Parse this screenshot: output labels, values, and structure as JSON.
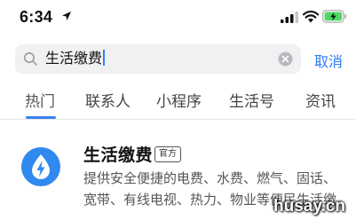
{
  "status_bar": {
    "time": "6:34",
    "location_icon": "location-arrow-icon",
    "signal_icon": "cellular-signal-icon",
    "wifi_icon": "wifi-icon",
    "battery_icon": "battery-charging-icon",
    "battery_color": "#4cd964"
  },
  "search": {
    "icon": "search-icon",
    "value": "生活缴费",
    "clear_icon": "clear-icon",
    "cancel_label": "取消"
  },
  "tabs": [
    {
      "label": "热门",
      "active": true
    },
    {
      "label": "联系人",
      "active": false
    },
    {
      "label": "小程序",
      "active": false
    },
    {
      "label": "生活号",
      "active": false
    },
    {
      "label": "资讯",
      "active": false
    }
  ],
  "result": {
    "logo_icon": "water-drop-lightning-icon",
    "logo_color": "#2f89ef",
    "title": "生活缴费",
    "badge": "官方",
    "description_line1": "提供安全便捷的电费、水费、燃气、固话、",
    "description_line2": "宽带、有线电视、热力、物业等便民生活缴"
  },
  "watermark": "husay.cn",
  "colors": {
    "accent": "#2d7cf0",
    "search_bg": "#f1f1f3"
  }
}
